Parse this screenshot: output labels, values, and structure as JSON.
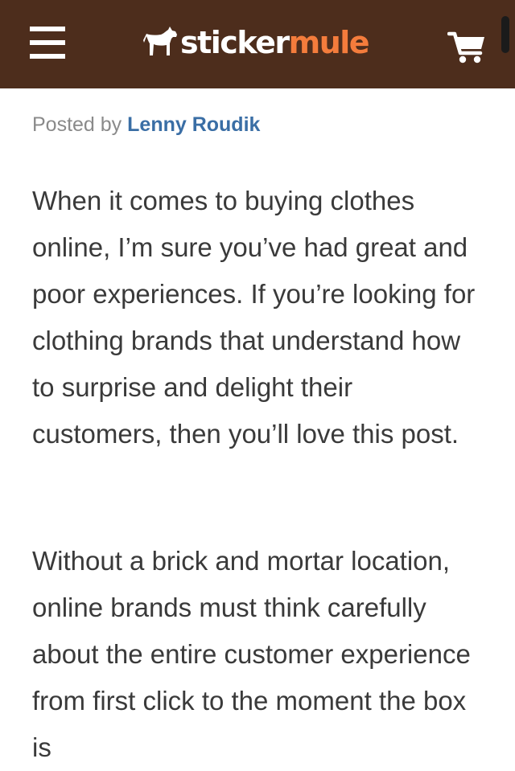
{
  "header": {
    "menu_icon": "hamburger-menu-icon",
    "logo": {
      "word_1": "sticker",
      "word_2": "mule",
      "word_2_color": "#f47c3c",
      "mascot_icon": "mule-icon"
    },
    "cart_icon": "shopping-cart-icon",
    "background_color": "#4d2d1c"
  },
  "post": {
    "posted_by_label": "Posted by",
    "author": "Lenny Roudik",
    "author_color": "#3a6ea5",
    "paragraphs": [
      "When it comes to buying clothes online, I’m sure you’ve had great and poor experiences. If you’re looking for clothing brands that understand how to surprise and delight their customers, then you’ll love this post.",
      "Without a brick and mortar location, online brands must think carefully about the entire customer experience from first click to the moment the box is"
    ]
  }
}
